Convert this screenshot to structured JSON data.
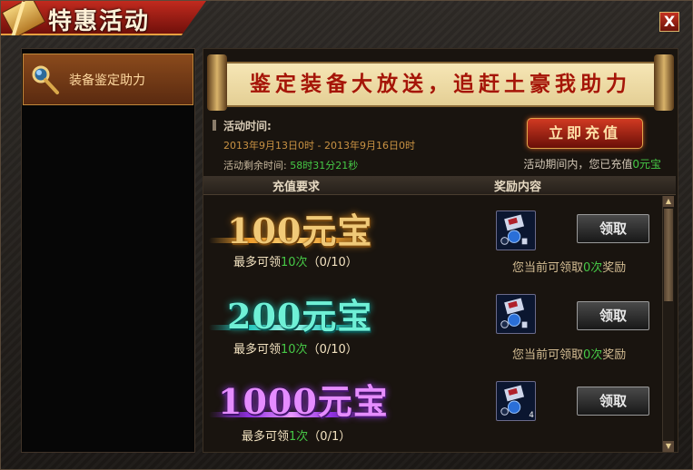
{
  "window": {
    "title": "特惠活动",
    "close_label": "X"
  },
  "sidebar": {
    "items": [
      {
        "label": "装备鉴定助力"
      }
    ]
  },
  "banner": {
    "text": "鉴定装备大放送，追赶土豪我助力"
  },
  "activity": {
    "heading": "活动时间:",
    "range": "2013年9月13日0时 - 2013年9月16日0时",
    "remaining_label": "活动剩余时间:",
    "remaining_value": "58时31分21秒",
    "charge_button": "立即充值",
    "charged_prefix": "活动期间内，您已充值",
    "charged_value": "0元宝"
  },
  "table": {
    "col_requirement": "充值要求",
    "col_reward": "奖励内容"
  },
  "tiers": [
    {
      "amount": "100元宝",
      "limit_prefix": "最多可领",
      "limit_value": "10次",
      "limit_progress": "（0/10）",
      "claim": "领取",
      "can_prefix": "您当前可领取",
      "can_value": "0次",
      "can_suffix": "奖励",
      "count_badge": ""
    },
    {
      "amount": "200元宝",
      "limit_prefix": "最多可领",
      "limit_value": "10次",
      "limit_progress": "（0/10）",
      "claim": "领取",
      "can_prefix": "您当前可领取",
      "can_value": "0次",
      "can_suffix": "奖励",
      "count_badge": ""
    },
    {
      "amount": "1000元宝",
      "limit_prefix": "最多可领",
      "limit_value": "1次",
      "limit_progress": "（0/1）",
      "claim": "领取",
      "count_badge": "4"
    }
  ],
  "colors": {
    "tier1": "#e8a64c",
    "tier2": "#4fe0c8",
    "tier3": "#c060e8",
    "highlight_green": "#46c846",
    "title_red": "#a51508"
  },
  "icons": {
    "title": "gift-banner-icon",
    "sidebar": "magnifier-staff-icon",
    "reward": "appraisal-scroll-icon"
  }
}
